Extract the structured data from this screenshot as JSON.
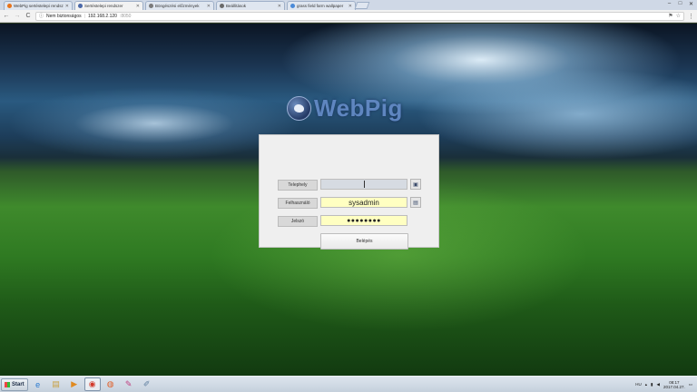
{
  "browser": {
    "tabs": [
      {
        "title": "WebPig sertéstelepi rendsz",
        "favicon_color": "#e8731a",
        "active": false
      },
      {
        "title": "Sertéstelepi rendszer",
        "favicon_color": "#4a68a8",
        "active": true
      },
      {
        "title": "Böngészési előzmények",
        "favicon_color": "#7a7a7a",
        "active": false
      },
      {
        "title": "Beállítások",
        "favicon_color": "#6a6a6a",
        "active": false
      },
      {
        "title": "grass field farm wallpaper",
        "favicon_color": "#4a8ad8",
        "active": false
      }
    ],
    "window_buttons": [
      "–",
      "□",
      "✕"
    ],
    "nav": {
      "back": "←",
      "forward": "→",
      "reload": "C"
    },
    "address": {
      "security_label": "Nem biztonságos",
      "host": "192.168.2.120",
      "port": ":8050"
    },
    "toolbar_icons": {
      "flag": "⚑",
      "star": "☆",
      "menu": "⋮"
    }
  },
  "app": {
    "logo_text": "WebPig",
    "login": {
      "site_label": "Telephely",
      "site_value": "",
      "user_label": "Felhasználó",
      "user_value": "sysadmin",
      "password_label": "Jelszó",
      "password_value": "●●●●●●●●",
      "submit_label": "Belépés"
    }
  },
  "taskbar": {
    "start_label": "Start",
    "apps": [
      {
        "name": "ie",
        "glyph": "e"
      },
      {
        "name": "explorer",
        "glyph": "▤"
      },
      {
        "name": "media-player",
        "glyph": "▶"
      },
      {
        "name": "chrome",
        "glyph": "◉",
        "active": true
      },
      {
        "name": "firefox",
        "glyph": "◍"
      },
      {
        "name": "paint",
        "glyph": "✎"
      },
      {
        "name": "tools",
        "glyph": "✐"
      }
    ],
    "language": "HU",
    "time": "08:17",
    "date": "2017.04.27."
  }
}
